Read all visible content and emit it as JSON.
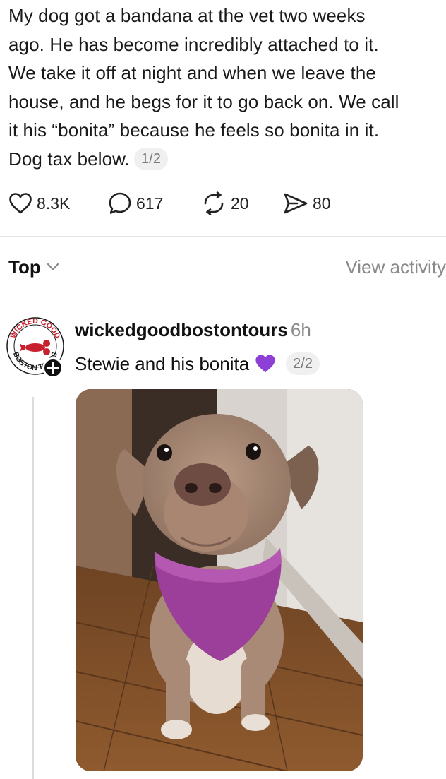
{
  "post": {
    "text_lines": [
      "My dog got a bandana at the vet two weeks",
      "ago. He has become incredibly attached to it.",
      "We take it off at night and when we leave the",
      "house, and he begs for it to go back on. We call",
      "it his “bonita” because he feels so bonita in it.",
      "Dog tax below."
    ],
    "page_indicator": "1/2"
  },
  "actions": {
    "likes": "8.3K",
    "replies": "617",
    "reposts": "20",
    "shares": "80"
  },
  "sort": {
    "label": "Top",
    "view_activity": "View activity"
  },
  "reply": {
    "username": "wickedgoodbostontours",
    "time": "6h",
    "text": "Stewie and his bonita",
    "emoji": "purple-heart",
    "page_indicator": "2/2",
    "avatar_text": {
      "top": "WICKED GOOD",
      "bottom": "BOSTON TOURS"
    }
  },
  "colors": {
    "text": "#111111",
    "muted": "#8a8a8a",
    "divider": "#e4e4e4",
    "badge_bg": "#f0f0f0",
    "purple_heart": "#8e3fd6",
    "avatar_red": "#c8202f"
  },
  "icons": {
    "like": "heart-outline-icon",
    "reply": "speech-bubble-icon",
    "repost": "repost-arrows-icon",
    "share": "send-arrow-icon",
    "sort": "chevron-down-icon"
  }
}
